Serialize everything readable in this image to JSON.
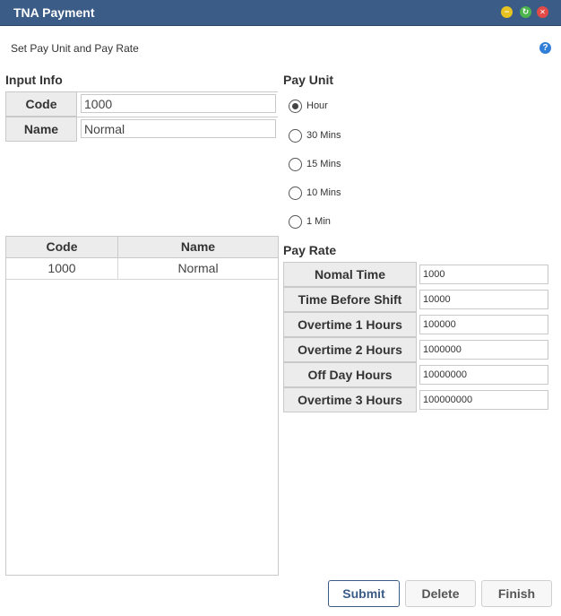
{
  "window": {
    "title": "TNA Payment",
    "subtitle": "Set Pay Unit and Pay Rate",
    "controls": [
      "minimize-icon",
      "restore-icon",
      "close-icon"
    ],
    "help_glyph": "?"
  },
  "input_info": {
    "heading": "Input Info",
    "code_label": "Code",
    "code_value": "1000",
    "name_label": "Name",
    "name_value": "Normal"
  },
  "grid": {
    "columns": [
      "Code",
      "Name"
    ],
    "rows": [
      {
        "code": "1000",
        "name": "Normal"
      }
    ]
  },
  "pay_unit": {
    "heading": "Pay Unit",
    "options": [
      {
        "label": "Hour",
        "selected": true
      },
      {
        "label": "30 Mins",
        "selected": false
      },
      {
        "label": "15 Mins",
        "selected": false
      },
      {
        "label": "10 Mins",
        "selected": false
      },
      {
        "label": "1 Min",
        "selected": false
      }
    ]
  },
  "pay_rate": {
    "heading": "Pay Rate",
    "rows": [
      {
        "label": "Nomal Time",
        "value": "1000"
      },
      {
        "label": "Time Before Shift",
        "value": "10000"
      },
      {
        "label": "Overtime 1 Hours",
        "value": "100000"
      },
      {
        "label": "Overtime 2 Hours",
        "value": "1000000"
      },
      {
        "label": "Off Day Hours",
        "value": "10000000"
      },
      {
        "label": "Overtime 3 Hours",
        "value": "100000000"
      }
    ]
  },
  "buttons": {
    "submit": "Submit",
    "delete": "Delete",
    "finish": "Finish"
  },
  "colors": {
    "titlebar": "#3b5c86",
    "minimize": "#e7c322",
    "restore": "#4db54d",
    "close": "#e14a47",
    "help": "#2f7fd8"
  }
}
